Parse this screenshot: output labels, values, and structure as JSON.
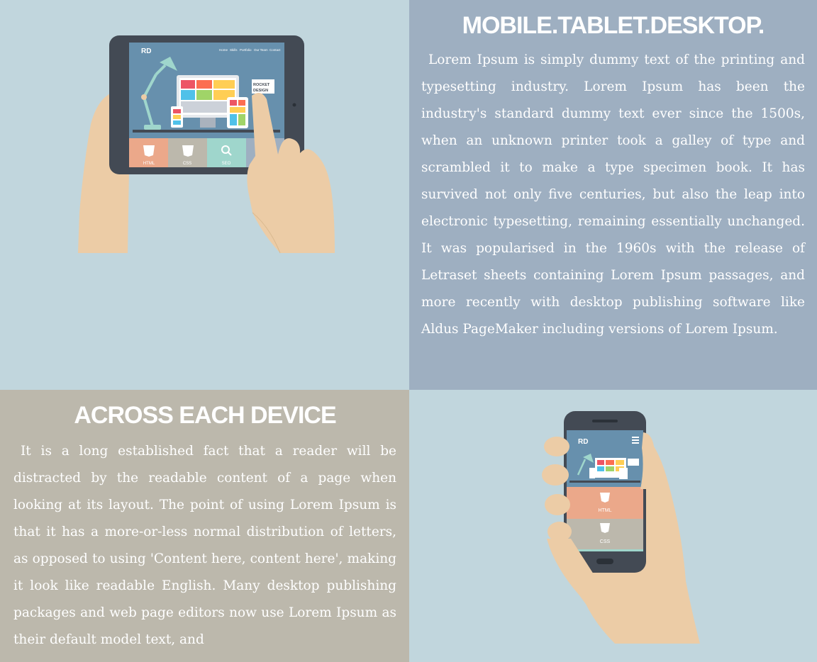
{
  "sections": {
    "devices_top": {
      "title": "MOBILE.TABLET.DESKTOP.",
      "text": "Lorem Ipsum is simply dummy text of the printing and typesetting industry. Lorem Ipsum has been the industry's standard dummy text ever since the 1500s, when an unknown printer took a galley of type and scrambled it to make a type specimen book. It has survived not only five centuries, but also the leap into electronic typesetting, remaining essentially unchanged. It was popularised in the 1960s with the release of Letraset sheets containing Lorem Ipsum passages, and more recently with desktop publishing software like Aldus PageMaker including versions of Lorem Ipsum."
    },
    "devices_bottom": {
      "title": "ACROSS EACH DEVICE",
      "text": "It is a long established fact that a reader will be distracted by the readable content of a page when looking at its layout. The point of using Lorem Ipsum is that it has a more-or-less normal distribution of letters, as opposed to using 'Content here, content here', making it look like readable English. Many desktop publishing packages and web page editors now use Lorem Ipsum as their default model text, and"
    }
  },
  "tablet_illustration": {
    "logo": "RD",
    "nav": [
      "Home",
      "Skills",
      "Portfolio",
      "Our Team",
      "Contact"
    ],
    "badge": [
      "ROCKET",
      "DESIGN"
    ],
    "tiles": [
      "HTML",
      "CSS",
      "SEO"
    ]
  },
  "phone_illustration": {
    "logo": "RD",
    "tiles": [
      "HTML",
      "CSS"
    ]
  },
  "colors": {
    "panel_light": "#c1d6dd",
    "panel_blue": "#9eafc1",
    "panel_beige": "#bcb8ac",
    "device_frame": "#434a54",
    "skin": "#ecccA6",
    "html_tile": "#eba88a",
    "css_tile": "#bcb8ac",
    "seo_tile": "#9fd6cc"
  },
  "icons": [
    "tablet-hands-illustration",
    "phone-hand-illustration",
    "html5-icon",
    "css3-icon",
    "search-icon",
    "menu-icon",
    "desk-lamp-icon"
  ]
}
